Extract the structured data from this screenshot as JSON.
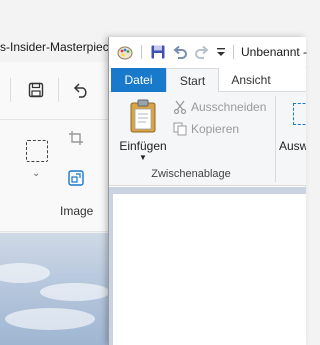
{
  "background_window": {
    "title": "s-Insider-Masterpiece",
    "image_group_label": "Image"
  },
  "foreground_window": {
    "title": "Unbenannt -",
    "tabs": [
      {
        "label": "Datei"
      },
      {
        "label": "Start"
      },
      {
        "label": "Ansicht"
      }
    ],
    "clipboard": {
      "paste_label": "Einfügen",
      "cut_label": "Ausschneiden",
      "copy_label": "Kopieren",
      "group_label": "Zwischenablage"
    },
    "select_label": "Ausw"
  },
  "colors": {
    "accent": "#1979ca",
    "disabled_text": "#9a9a9a",
    "ribbon_bg": "#f5f6f7"
  }
}
